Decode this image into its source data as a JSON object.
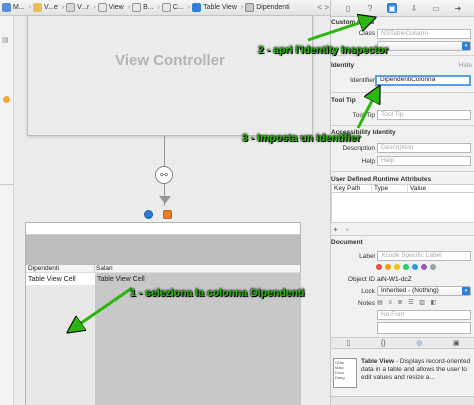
{
  "breadcrumb": {
    "items": [
      "M...",
      "V...e",
      "V...r",
      "View",
      "B...",
      "C...",
      "Table View",
      "Dipendenti"
    ],
    "nav": "< >"
  },
  "canvas": {
    "view_controller_title": "View Controller",
    "table_header_col1": "Dipendenti",
    "table_header_col2": "Salari",
    "cell_col1": "Table View Cell",
    "cell_col2": "Table View Cell"
  },
  "inspector": {
    "custom_class_title": "Custom Class",
    "class_label": "Class",
    "class_placeholder": "NSTableColumn",
    "identity_title": "Identity",
    "identity_hide": "Hide",
    "identifier_label": "Identifier",
    "identifier_value": "DipendentiColonna",
    "tool_tip_title": "Tool Tip",
    "tool_tip_label": "Tool Tip",
    "tool_tip_placeholder": "Tool Tip",
    "accessibility_title": "Accessibility Identity",
    "description_label": "Description",
    "description_placeholder": "Description",
    "help_label": "Help",
    "help_placeholder": "Help",
    "udra_title": "User Defined Runtime Attributes",
    "udra_key_path": "Key Path",
    "udra_type": "Type",
    "udra_value": "Value",
    "plus_minus": "+ -",
    "document_title": "Document",
    "label_label": "Label",
    "label_placeholder": "Xcode Specific Label",
    "object_id_label": "Object ID",
    "object_id_value": "aiN-W1-dcZ",
    "lock_label": "Lock",
    "lock_value": "Inherited - (Nothing)",
    "notes_label": "Notes",
    "no_font_placeholder": "No Font",
    "lib_item_title": "Table View",
    "lib_item_desc": " - Displays record-oriented data in a table and allows the user to edit values and resize a...",
    "lib_thumb_lines": [
      "Grab",
      "Malo",
      "Doco",
      "Dang"
    ],
    "swatch_colors": [
      "#e74c3c",
      "#f39c12",
      "#f1c40f",
      "#2ecc71",
      "#3498db",
      "#9b59b6",
      "#95a5a6"
    ]
  },
  "annotations": {
    "step1": "1 - seleziona la colonna Dipendenti",
    "step2": "2 - apri l'Identity Inspector",
    "step3": "3 - Imposta un Identifier",
    "color": "#2bb50e"
  }
}
